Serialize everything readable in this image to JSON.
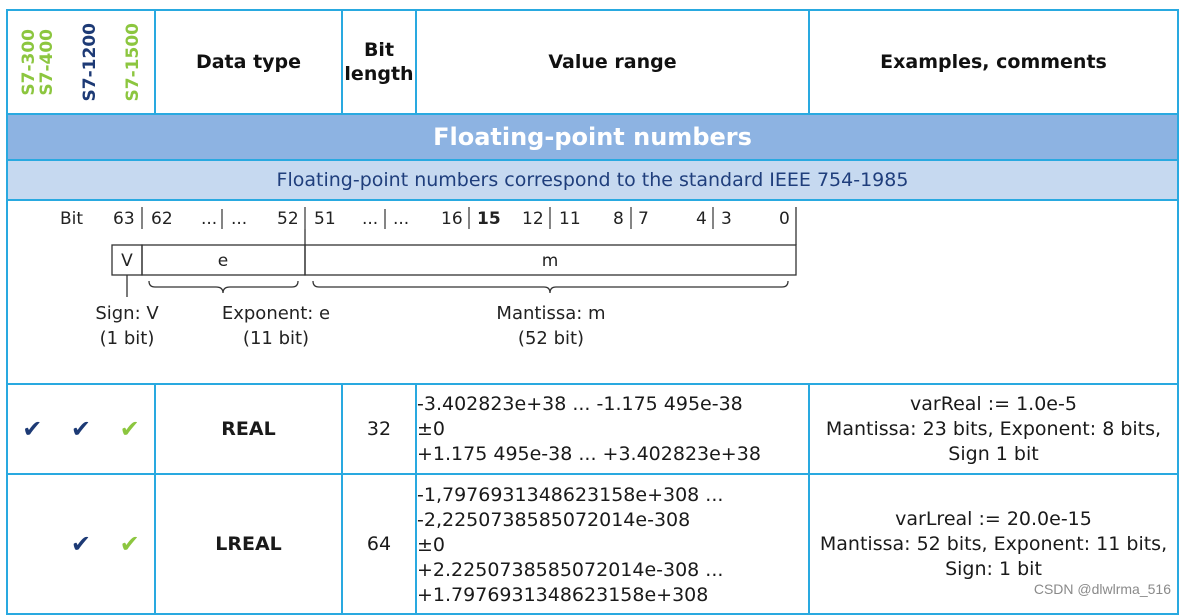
{
  "colors": {
    "border": "#29a9e0",
    "green": "#8cc63f",
    "navy": "#1d3a75",
    "section_bg": "#8db3e2",
    "subsection_bg": "#c6d9f0"
  },
  "header": {
    "plc_columns": [
      {
        "lines": [
          "S7-300",
          "S7-400"
        ],
        "color": "#8cc63f"
      },
      {
        "lines": [
          "S7-1200"
        ],
        "color": "#1d3a75"
      },
      {
        "lines": [
          "S7-1500"
        ],
        "color": "#8cc63f"
      }
    ],
    "data_type": "Data type",
    "bit_length_line1": "Bit",
    "bit_length_line2": "length",
    "value_range": "Value range",
    "examples": "Examples, comments"
  },
  "section": {
    "title": "Floating-point numbers",
    "subtitle": "Floating-point numbers correspond to the standard IEEE 754-1985"
  },
  "diagram": {
    "bit_label": "Bit",
    "bit_numbers": [
      "63",
      "62",
      "...",
      "...",
      "52",
      "51",
      "...",
      "...",
      "16",
      "15",
      "12",
      "11",
      "8",
      "7",
      "4",
      "3",
      "0"
    ],
    "field_v": "V",
    "field_e": "e",
    "field_m": "m",
    "sign_label": "Sign: V",
    "sign_bits": "(1 bit)",
    "exponent_label": "Exponent: e",
    "exponent_bits": "(11 bit)",
    "mantissa_label": "Mantissa: m",
    "mantissa_bits": "(52 bit)"
  },
  "rows": [
    {
      "checks": [
        {
          "mark": "✔",
          "color": "#1d3a75"
        },
        {
          "mark": "✔",
          "color": "#1d3a75"
        },
        {
          "mark": "✔",
          "color": "#8cc63f"
        }
      ],
      "type": "REAL",
      "bits": "32",
      "range": [
        "-3.402823e+38 ... -1.175 495e-38",
        "±0",
        "+1.175 495e-38 ... +3.402823e+38"
      ],
      "comment": [
        "varReal := 1.0e-5",
        "Mantissa: 23 bits, Exponent: 8 bits,",
        "Sign 1 bit"
      ]
    },
    {
      "checks": [
        {
          "mark": "",
          "color": "#1d3a75"
        },
        {
          "mark": "✔",
          "color": "#1d3a75"
        },
        {
          "mark": "✔",
          "color": "#8cc63f"
        }
      ],
      "type": "LREAL",
      "bits": "64",
      "range": [
        "-1,7976931348623158e+308 ...",
        "-2,2250738585072014e-308",
        "±0",
        "+2.2250738585072014e-308 ...",
        "+1.7976931348623158e+308"
      ],
      "comment": [
        "varLreal := 20.0e-15",
        "Mantissa: 52 bits, Exponent: 11 bits,",
        "Sign: 1 bit"
      ]
    }
  ],
  "watermark": "CSDN @dlwlrma_516"
}
